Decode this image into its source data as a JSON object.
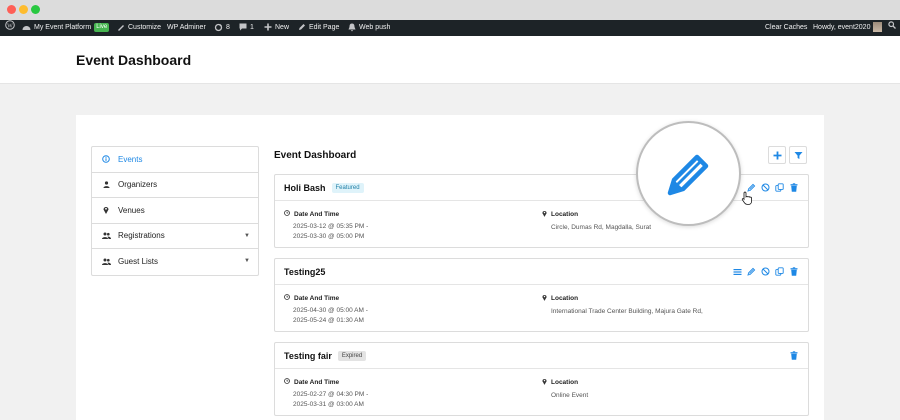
{
  "adminbar": {
    "site_name": "My Event Platform",
    "live_badge": "Live",
    "customize": "Customize",
    "wp_adminer": "WP Adminer",
    "updates_count": "8",
    "comments_count": "1",
    "new": "New",
    "edit_page": "Edit Page",
    "web_push": "Web push",
    "clear_caches": "Clear Caches",
    "howdy": "Howdy, event2020"
  },
  "page": {
    "title": "Event Dashboard"
  },
  "sidebar": {
    "items": [
      {
        "label": "Events",
        "icon": "info-circle-icon",
        "active": true
      },
      {
        "label": "Organizers",
        "icon": "user-icon",
        "active": false
      },
      {
        "label": "Venues",
        "icon": "map-marker-icon",
        "active": false
      },
      {
        "label": "Registrations",
        "icon": "users-icon",
        "active": false,
        "has_submenu": true
      },
      {
        "label": "Guest Lists",
        "icon": "users-icon",
        "active": false,
        "has_submenu": true
      }
    ]
  },
  "main": {
    "title": "Event Dashboard",
    "header_buttons": [
      "plus-icon",
      "filter-icon"
    ],
    "field_labels": {
      "date": "Date And Time",
      "location": "Location"
    },
    "events": [
      {
        "name": "Holi Bash",
        "badge": "Featured",
        "date_start": "2025-03-12 @ 05:35 PM -",
        "date_end": "2025-03-30 @ 05:00 PM",
        "location": "Circle, Dumas Rd, Magdalla, Surat",
        "actions": [
          "edit-icon",
          "cancel-icon",
          "duplicate-icon",
          "trash-icon"
        ]
      },
      {
        "name": "Testing25",
        "badge": "",
        "date_start": "2025-04-30 @ 05:00 AM -",
        "date_end": "2025-05-24 @ 01:30 AM",
        "location": "International Trade Center Building, Majura Gate Rd,",
        "actions": [
          "menu-icon",
          "edit-icon",
          "cancel-icon",
          "duplicate-icon",
          "trash-icon"
        ]
      },
      {
        "name": "Testing fair",
        "badge": "Expired",
        "date_start": "2025-02-27 @ 04:30 PM -",
        "date_end": "2025-03-31 @ 03:00 AM",
        "location": "Online Event",
        "actions": [
          "trash-icon"
        ]
      }
    ]
  },
  "colors": {
    "accent": "#1e88e5",
    "adminbar": "#1d2327",
    "live": "#46b450"
  }
}
